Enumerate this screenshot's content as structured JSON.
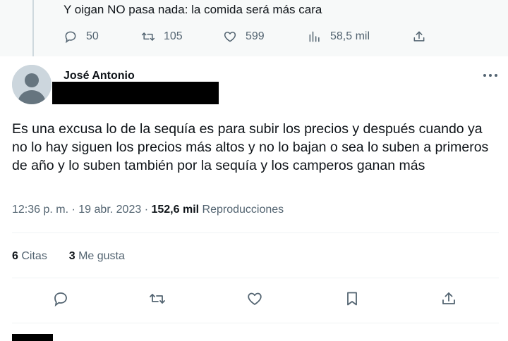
{
  "previous_tweet": {
    "text": "Y oigan NO pasa nada: la comida será más cara",
    "replies": "50",
    "retweets": "105",
    "likes": "599",
    "views": "58,5 mil"
  },
  "tweet": {
    "author_name": "José Antonio",
    "text": "Es una excusa lo de la sequía es para subir los precios y después cuando ya no lo hay siguen los precios más altos y no lo bajan o sea lo suben a primeros de año y lo suben también por la sequía y los camperos ganan más",
    "time": "12:36 p. m.",
    "separator": "·",
    "date": "19 abr. 2023",
    "views_count": "152,6 mil",
    "views_label": "Reproducciones",
    "quotes_count": "6",
    "quotes_label": "Citas",
    "likes_count": "3",
    "likes_label": "Me gusta"
  },
  "icons": {
    "reply": "reply-icon",
    "retweet": "retweet-icon",
    "like": "heart-icon",
    "views": "views-chart-icon",
    "share": "share-icon",
    "bookmark": "bookmark-icon",
    "more": "more-icon"
  },
  "colors": {
    "text": "#0f1419",
    "secondary": "#536471",
    "divider": "#eff3f4",
    "background_prev": "#f7f9f9"
  }
}
